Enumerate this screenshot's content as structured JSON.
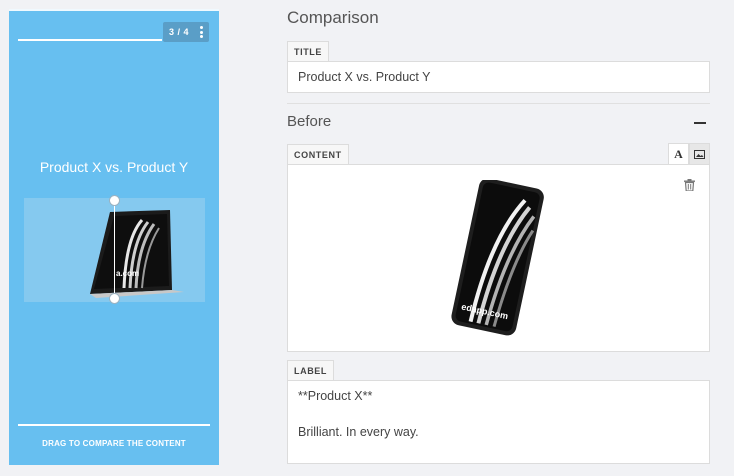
{
  "preview": {
    "page_indicator": "3 / 4",
    "title": "Product X vs. Product Y",
    "drag_caption": "DRAG TO COMPARE THE CONTENT",
    "laptop_watermark": "a.com"
  },
  "editor": {
    "heading": "Comparison",
    "title_tab": "TITLE",
    "title_value": "Product X vs. Product Y",
    "section_heading": "Before",
    "content_tab": "CONTENT",
    "phone_watermark": "edapp.com",
    "label_tab": "LABEL",
    "label_line1": "**Product X**",
    "label_line2": "Brilliant. In every way."
  },
  "colors": {
    "preview_bg": "#67bff0",
    "page_bg": "#f1f2f5"
  },
  "icons": [
    "kebab-menu-icon",
    "collapse-icon",
    "text-type-icon",
    "image-type-icon",
    "trash-icon"
  ]
}
